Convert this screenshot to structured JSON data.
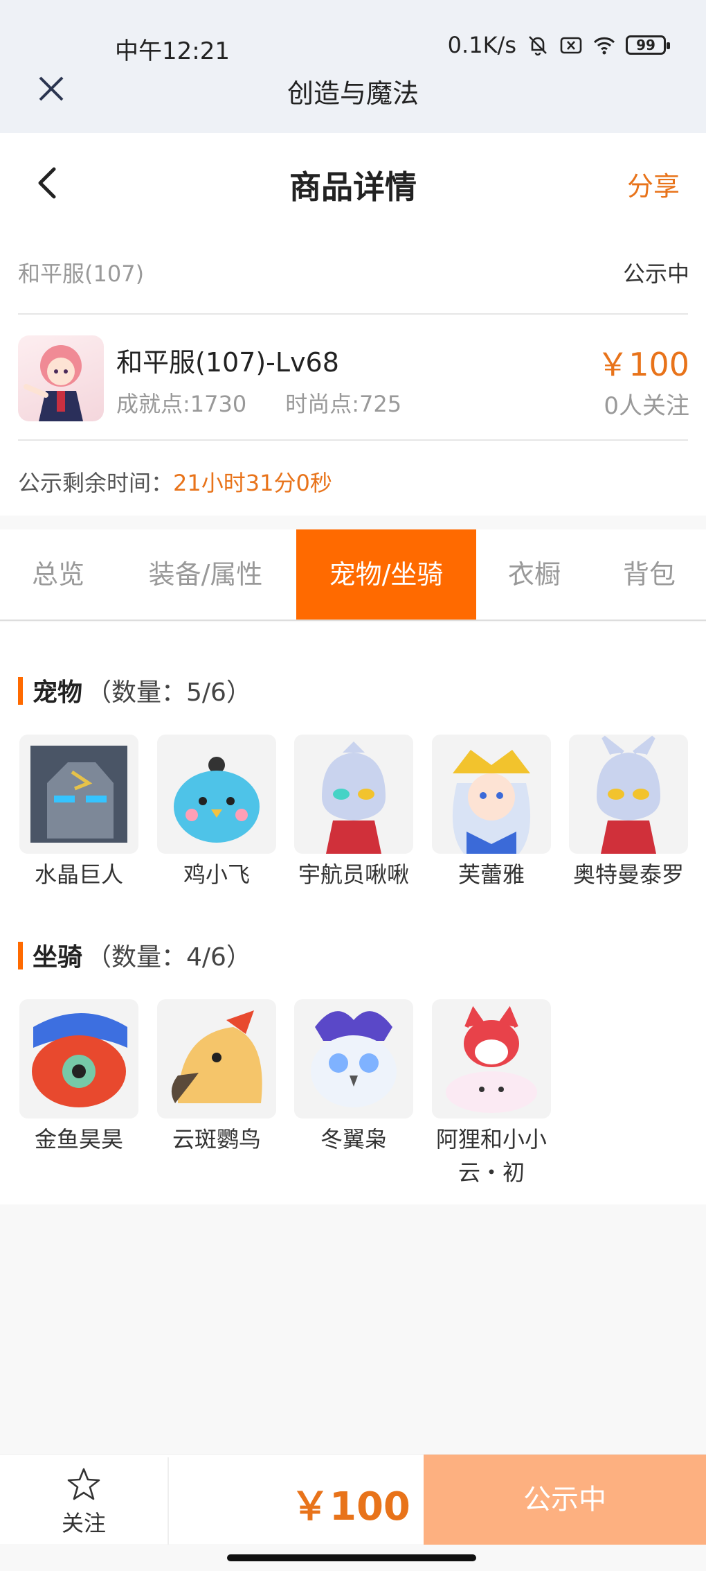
{
  "status_bar": {
    "time": "中午12:21",
    "net_speed": "0.1K/s",
    "battery": "99",
    "icons": [
      "mute-bell-icon",
      "close-square-icon",
      "wifi-icon",
      "battery-icon"
    ]
  },
  "mini_program": {
    "title": "创造与魔法",
    "close_icon": "close-icon"
  },
  "header": {
    "title": "商品详情",
    "share_label": "分享",
    "back_icon": "chevron-left-icon"
  },
  "info": {
    "server": "和平服(107)",
    "status": "公示中",
    "role_name": "和平服(107)-Lv68",
    "achievement": "成就点:1730",
    "fashion": "时尚点:725",
    "price": "￥100",
    "followers": "0人关注",
    "remain_label": "公示剩余时间：",
    "remain_value": "21小时31分0秒"
  },
  "tabs": [
    "总览",
    "装备/属性",
    "宠物/坐骑",
    "衣橱",
    "背包"
  ],
  "active_tab": 2,
  "pets": {
    "title": "宠物",
    "count": "（数量：5/6）",
    "items": [
      {
        "name": "水晶巨人"
      },
      {
        "name": "鸡小飞"
      },
      {
        "name": "宇航员啾啾"
      },
      {
        "name": "芙蕾雅"
      },
      {
        "name": "奥特曼泰罗"
      }
    ]
  },
  "mounts": {
    "title": "坐骑",
    "count": "（数量：4/6）",
    "items": [
      {
        "name": "金鱼昊昊"
      },
      {
        "name": "云斑鹦鸟"
      },
      {
        "name": "冬翼枭"
      },
      {
        "name": "阿狸和小小云・初"
      }
    ]
  },
  "bottom": {
    "follow_label": "关注",
    "price": "￥100",
    "action_label": "公示中"
  },
  "colors": {
    "accent": "#ff6a00",
    "price": "#e8731a",
    "action_disabled": "#fdb080"
  }
}
